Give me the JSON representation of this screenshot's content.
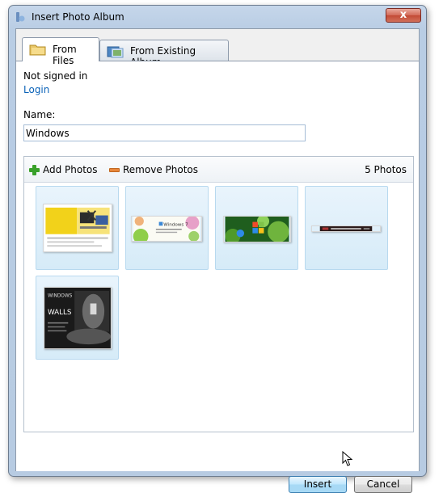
{
  "window": {
    "title": "Insert Photo Album",
    "close_label": "x"
  },
  "tabs": [
    {
      "label": "From Files",
      "icon": "folder-icon",
      "active": true
    },
    {
      "label": "From Existing Album",
      "icon": "photo-album-icon",
      "active": false
    }
  ],
  "account": {
    "status": "Not signed in",
    "login_label": "Login"
  },
  "name_field": {
    "label": "Name:",
    "value": "Windows"
  },
  "photos": {
    "add_label": "Add Photos",
    "remove_label": "Remove Photos",
    "count_label": "5 Photos",
    "items": [
      {
        "icon": "yellow-brochure-photo"
      },
      {
        "icon": "windows7-banner-photo",
        "text": "Windows 7"
      },
      {
        "icon": "green-windows-logo-photo"
      },
      {
        "icon": "dark-strip-photo"
      },
      {
        "icon": "windows-on-walls-photo",
        "text_line1": "WINDOWS",
        "text_line2": "WALLS"
      }
    ]
  },
  "buttons": {
    "insert_label": "Insert",
    "cancel_label": "Cancel"
  },
  "colors": {
    "link": "#0a62b8",
    "accent": "#3c7fb1",
    "thumb_bg": "#d6ebf8"
  }
}
